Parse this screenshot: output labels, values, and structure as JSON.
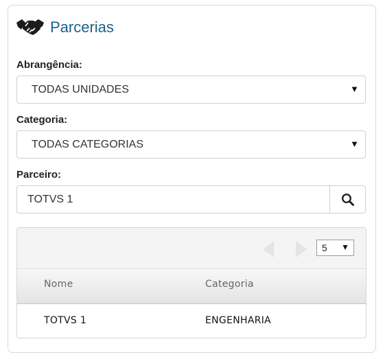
{
  "header": {
    "title": "Parcerias",
    "icon": "handshake-icon"
  },
  "abrangencia": {
    "label": "Abrangência:",
    "value": "TODAS UNIDADES"
  },
  "categoria": {
    "label": "Categoria:",
    "value": "TODAS CATEGORIAS"
  },
  "parceiro": {
    "label": "Parceiro:",
    "value": "TOTVS 1"
  },
  "grid": {
    "page_size": "5",
    "columns": [
      "Nome",
      "Categoria"
    ],
    "rows": [
      {
        "nome": "TOTVS 1",
        "categoria": "ENGENHARIA"
      }
    ]
  },
  "colors": {
    "title": "#1a5f8c"
  }
}
